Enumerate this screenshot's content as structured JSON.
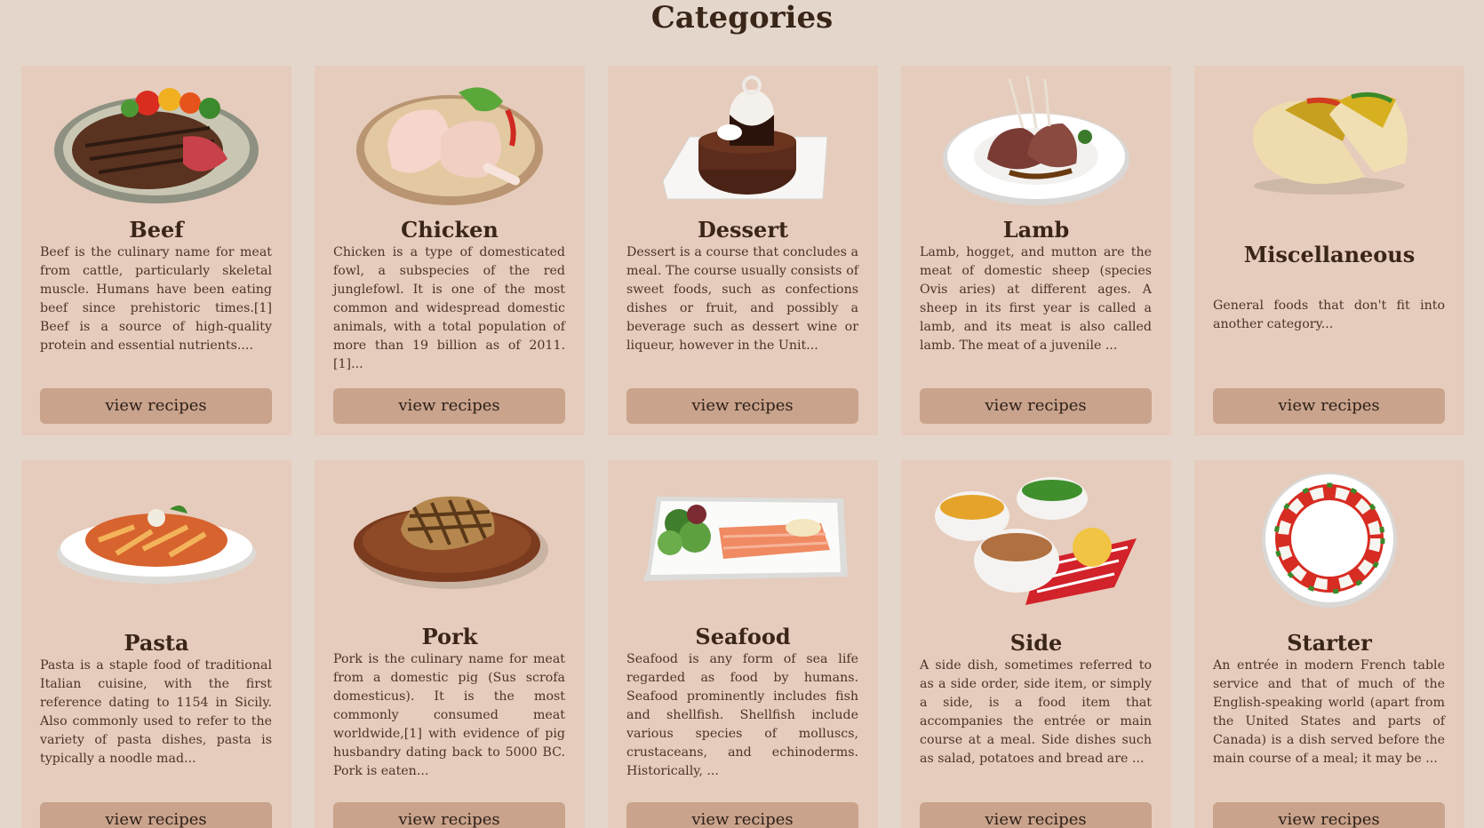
{
  "page": {
    "title": "Categories"
  },
  "categories": [
    {
      "name": "Beef",
      "description": "Beef is the culinary name for meat from cattle, particularly skeletal muscle. Humans have been eating beef since prehistoric times.[1] Beef is a source of high-quality protein and essential nutrients....",
      "button_label": "view recipes",
      "icon": "steak-plate-icon"
    },
    {
      "name": "Chicken",
      "description": "Chicken is a type of domesticated fowl, a subspecies of the red junglefowl. It is one of the most common and widespread domestic animals, with a total population of more than 19 billion as of 2011.[1]...",
      "button_label": "view recipes",
      "icon": "chicken-legs-icon"
    },
    {
      "name": "Dessert",
      "description": "Dessert is a course that concludes a meal. The course usually consists of sweet foods, such as confections dishes or fruit, and possibly a beverage such as dessert wine or liqueur, however in the Unit...",
      "button_label": "view recipes",
      "icon": "chocolate-cake-icon"
    },
    {
      "name": "Lamb",
      "description": "Lamb, hogget, and mutton are the meat of domestic sheep (species Ovis aries) at different ages. A sheep in its first year is called a lamb, and its meat is also called lamb. The meat of a juvenile ...",
      "button_label": "view recipes",
      "icon": "lamb-chops-icon"
    },
    {
      "name": "Miscellaneous",
      "description": "General foods that don't fit into another category...",
      "button_label": "view recipes",
      "icon": "tacos-icon"
    },
    {
      "name": "Pasta",
      "description": "Pasta is a staple food of traditional Italian cuisine, with the first reference dating to 1154 in Sicily. Also commonly used to refer to the variety of pasta dishes, pasta is typically a noodle mad...",
      "button_label": "view recipes",
      "icon": "pasta-bowl-icon"
    },
    {
      "name": "Pork",
      "description": "Pork is the culinary name for meat from a domestic pig (Sus scrofa domesticus). It is the most commonly consumed meat worldwide,[1] with evidence of pig husbandry dating back to 5000 BC. Pork is eaten...",
      "button_label": "view recipes",
      "icon": "pork-chop-board-icon"
    },
    {
      "name": "Seafood",
      "description": "Seafood is any form of sea life regarded as food by humans. Seafood prominently includes fish and shellfish. Shellfish include various species of molluscs, crustaceans, and echinoderms. Historically, ...",
      "button_label": "view recipes",
      "icon": "salmon-platter-icon"
    },
    {
      "name": "Side",
      "description": "A side dish, sometimes referred to as a side order, side item, or simply a side, is a food item that accompanies the entrée or main course at a meal. Side dishes such as salad, potatoes and bread are ...",
      "button_label": "view recipes",
      "icon": "side-bowls-icon"
    },
    {
      "name": "Starter",
      "description": "An entrée in modern French table service and that of much of the English-speaking world (apart from the United States and parts of Canada) is a dish served before the main course of a meal; it may be ...",
      "button_label": "view recipes",
      "icon": "caprese-plate-icon"
    }
  ]
}
